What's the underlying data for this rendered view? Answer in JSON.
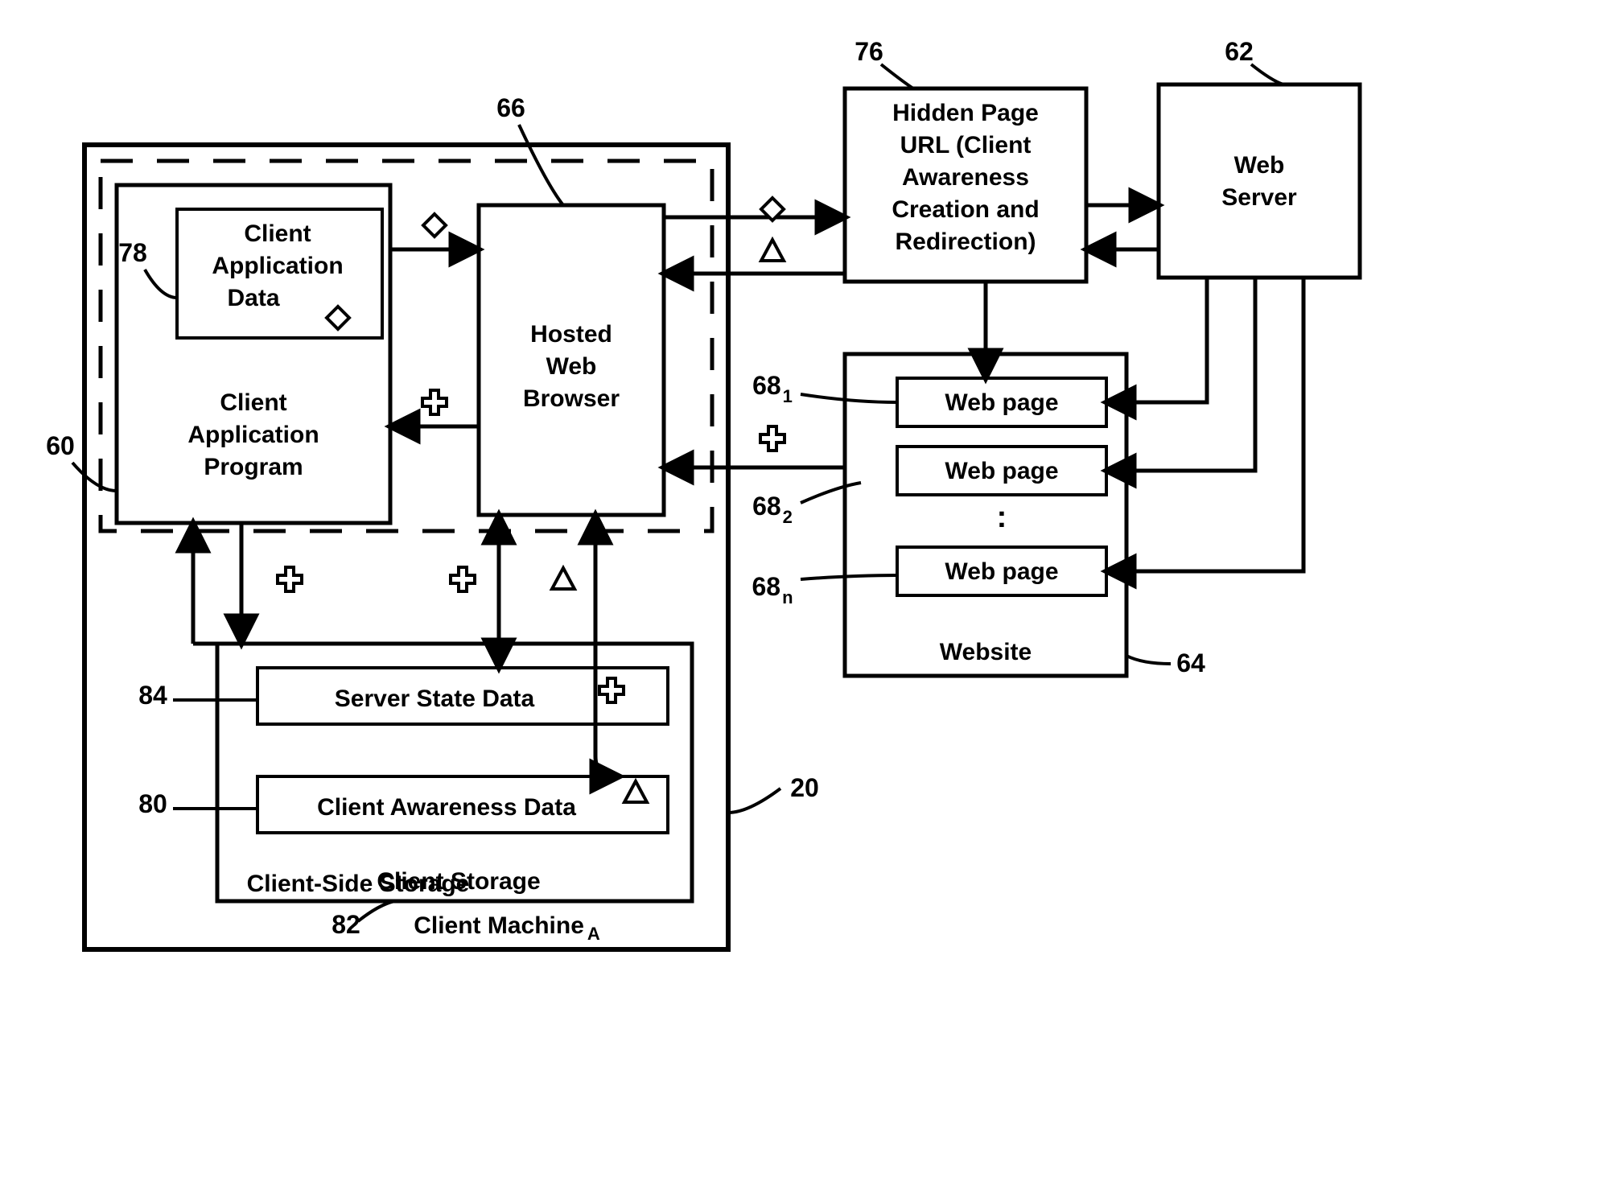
{
  "refs": {
    "client_machine": "20",
    "client_application_program": "60",
    "web_server": "62",
    "website": "64",
    "hosted_web_browser": "66",
    "web_page_1": "68",
    "web_page_1_sub": "1",
    "web_page_2": "68",
    "web_page_2_sub": "2",
    "web_page_n": "68",
    "web_page_n_sub": "n",
    "hidden_page": "76",
    "client_application_data": "78",
    "client_awareness_data": "80",
    "client_side_storage": "82",
    "server_state_data": "84"
  },
  "boxes": {
    "client_machine_label": "Client Machine",
    "client_machine_sub": "A",
    "client_application_program_l1": "Client",
    "client_application_program_l2": "Application",
    "client_application_program_l3": "Program",
    "client_application_data_l1": "Client",
    "client_application_data_l2": "Application",
    "client_application_data_l3": "Data",
    "hosted_web_browser_l1": "Hosted",
    "hosted_web_browser_l2": "Web",
    "hosted_web_browser_l3": "Browser",
    "client_side_storage_l1": "Client-Side Storage",
    "client_storage_label": "Client Storage",
    "server_state_data": "Server State Data",
    "client_awareness_data": "Client Awareness Data",
    "hidden_page_l1": "Hidden Page",
    "hidden_page_l2": "URL (Client",
    "hidden_page_l3": "Awareness",
    "hidden_page_l4": "Creation and",
    "hidden_page_l5": "Redirection)",
    "web_server_l1": "Web",
    "web_server_l2": "Server",
    "website": "Website",
    "web_page": "Web page",
    "vdots": ":"
  }
}
